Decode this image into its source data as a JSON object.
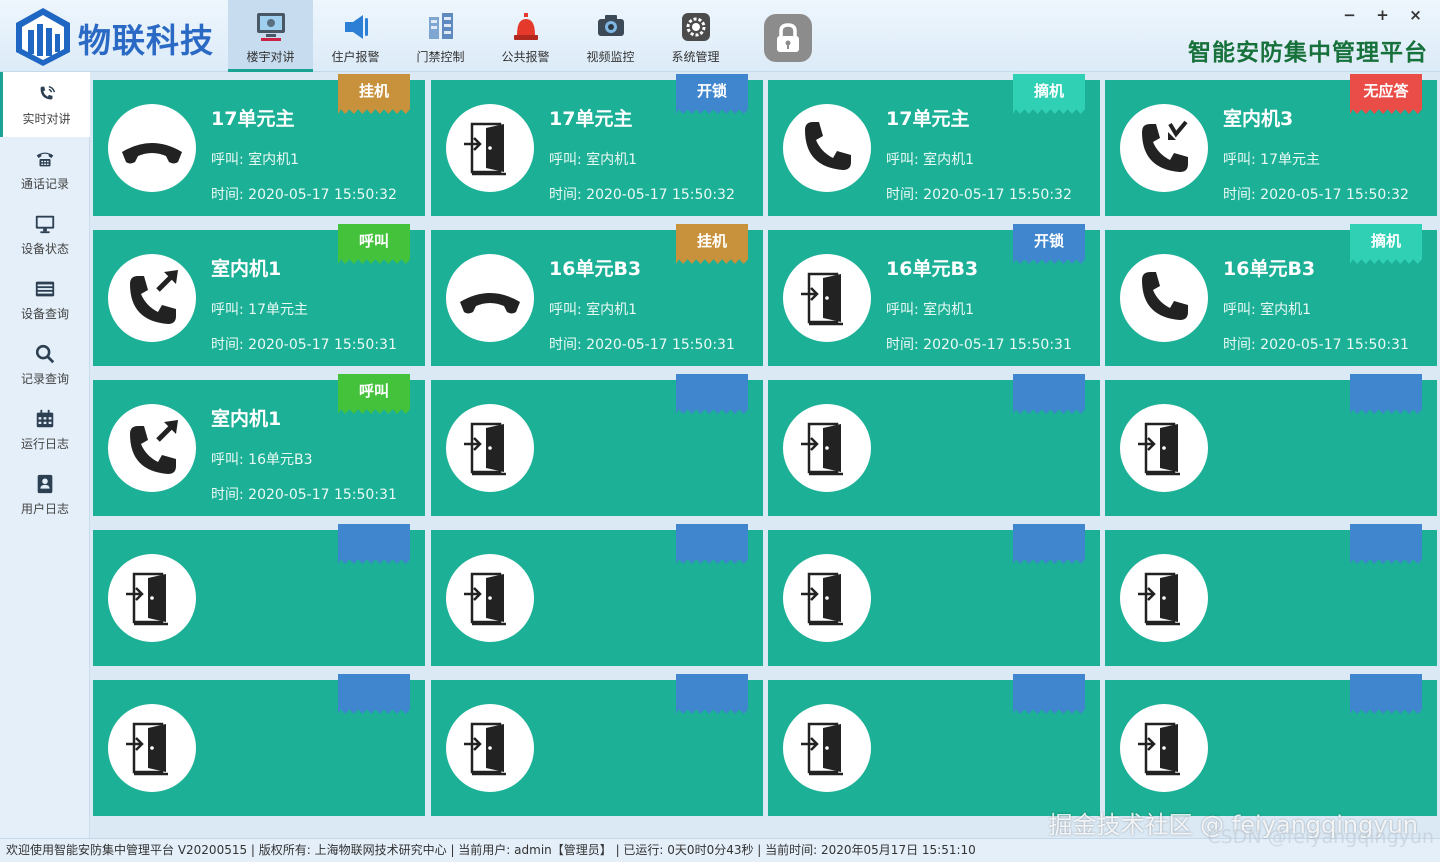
{
  "brand": {
    "name": "物联科技",
    "app_title": "智能安防集中管理平台"
  },
  "window_controls": {
    "minimize": "−",
    "maximize": "+",
    "close": "×"
  },
  "nav": [
    {
      "label": "楼宇对讲",
      "icon": "intercom-icon",
      "active": true
    },
    {
      "label": "住户报警",
      "icon": "alarm-horn-icon"
    },
    {
      "label": "门禁控制",
      "icon": "access-control-icon"
    },
    {
      "label": "公共报警",
      "icon": "siren-icon"
    },
    {
      "label": "视频监控",
      "icon": "camera-icon"
    },
    {
      "label": "系统管理",
      "icon": "gear-icon"
    }
  ],
  "sidebar": [
    {
      "label": "实时对讲",
      "icon": "phone-ring-icon",
      "active": true
    },
    {
      "label": "通话记录",
      "icon": "telephone-icon"
    },
    {
      "label": "设备状态",
      "icon": "monitor-icon"
    },
    {
      "label": "设备查询",
      "icon": "list-icon"
    },
    {
      "label": "记录查询",
      "icon": "search-icon"
    },
    {
      "label": "运行日志",
      "icon": "calendar-icon"
    },
    {
      "label": "用户日志",
      "icon": "user-card-icon"
    }
  ],
  "tag_colors": {
    "挂机": "#c8913b",
    "开锁": "#3f86cf",
    "摘机": "#2fd0b4",
    "无应答": "#ea4c48",
    "呼叫": "#44c23c",
    "": "#3f86cf"
  },
  "cards": [
    {
      "title": "17单元主",
      "caller": "呼叫: 室内机1",
      "time": "时间: 2020-05-17 15:50:32",
      "tag": "挂机",
      "icon": "hangup-icon"
    },
    {
      "title": "17单元主",
      "caller": "呼叫: 室内机1",
      "time": "时间: 2020-05-17 15:50:32",
      "tag": "开锁",
      "icon": "door-icon"
    },
    {
      "title": "17单元主",
      "caller": "呼叫: 室内机1",
      "time": "时间: 2020-05-17 15:50:32",
      "tag": "摘机",
      "icon": "phone-icon"
    },
    {
      "title": "室内机3",
      "caller": "呼叫: 17单元主",
      "time": "时间: 2020-05-17 15:50:32",
      "tag": "无应答",
      "icon": "missed-call-icon"
    },
    {
      "title": "室内机1",
      "caller": "呼叫: 17单元主",
      "time": "时间: 2020-05-17 15:50:31",
      "tag": "呼叫",
      "icon": "outgoing-call-icon"
    },
    {
      "title": "16单元B3",
      "caller": "呼叫: 室内机1",
      "time": "时间: 2020-05-17 15:50:31",
      "tag": "挂机",
      "icon": "hangup-icon"
    },
    {
      "title": "16单元B3",
      "caller": "呼叫: 室内机1",
      "time": "时间: 2020-05-17 15:50:31",
      "tag": "开锁",
      "icon": "door-icon"
    },
    {
      "title": "16单元B3",
      "caller": "呼叫: 室内机1",
      "time": "时间: 2020-05-17 15:50:31",
      "tag": "摘机",
      "icon": "phone-icon"
    },
    {
      "title": "室内机1",
      "caller": "呼叫: 16单元B3",
      "time": "时间: 2020-05-17 15:50:31",
      "tag": "呼叫",
      "icon": "outgoing-call-icon"
    },
    {
      "title": "",
      "caller": "",
      "time": "",
      "tag": "",
      "icon": "door-icon"
    },
    {
      "title": "",
      "caller": "",
      "time": "",
      "tag": "",
      "icon": "door-icon"
    },
    {
      "title": "",
      "caller": "",
      "time": "",
      "tag": "",
      "icon": "door-icon"
    },
    {
      "title": "",
      "caller": "",
      "time": "",
      "tag": "",
      "icon": "door-icon"
    },
    {
      "title": "",
      "caller": "",
      "time": "",
      "tag": "",
      "icon": "door-icon"
    },
    {
      "title": "",
      "caller": "",
      "time": "",
      "tag": "",
      "icon": "door-icon"
    },
    {
      "title": "",
      "caller": "",
      "time": "",
      "tag": "",
      "icon": "door-icon"
    },
    {
      "title": "",
      "caller": "",
      "time": "",
      "tag": "",
      "icon": "door-icon"
    },
    {
      "title": "",
      "caller": "",
      "time": "",
      "tag": "",
      "icon": "door-icon"
    },
    {
      "title": "",
      "caller": "",
      "time": "",
      "tag": "",
      "icon": "door-icon"
    },
    {
      "title": "",
      "caller": "",
      "time": "",
      "tag": "",
      "icon": "door-icon"
    }
  ],
  "status_bar": "欢迎使用智能安防集中管理平台 V20200515 | 版权所有: 上海物联网技术研究中心 | 当前用户: admin【管理员】 | 已运行: 0天0时0分43秒 | 当前时间: 2020年05月17日 15:51:10",
  "watermark": "掘金技术社区 @ feiyangqingyun",
  "watermark2": "CSDN @feiyangqingyun"
}
